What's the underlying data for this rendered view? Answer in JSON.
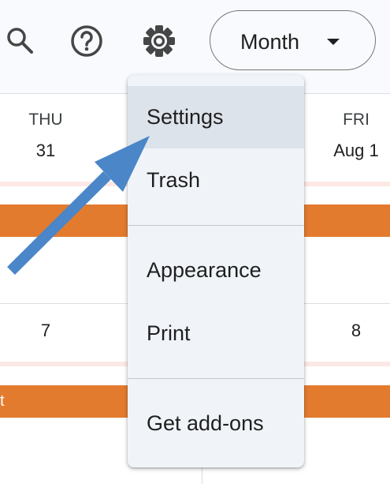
{
  "header": {
    "search_icon": "search-icon",
    "help_icon": "help-circle-icon",
    "settings_icon": "gear-icon",
    "view_select": {
      "selected": "Month",
      "icon": "caret-down-icon"
    }
  },
  "calendar": {
    "columns": [
      {
        "day": "THU",
        "date": "31",
        "next_date": "7"
      },
      {
        "day": "FRI",
        "date": "Aug 1",
        "next_date": "8"
      }
    ],
    "event_fragment_text": "t",
    "colors": {
      "event": "#e37b2e",
      "strip": "#fce8e6"
    }
  },
  "menu": {
    "items": [
      {
        "label": "Settings",
        "active": true
      },
      {
        "label": "Trash"
      },
      {
        "label": "Appearance"
      },
      {
        "label": "Print"
      },
      {
        "label": "Get add-ons"
      }
    ]
  },
  "annotation": {
    "arrow_color": "#4a86c8",
    "points_to": "Settings"
  }
}
